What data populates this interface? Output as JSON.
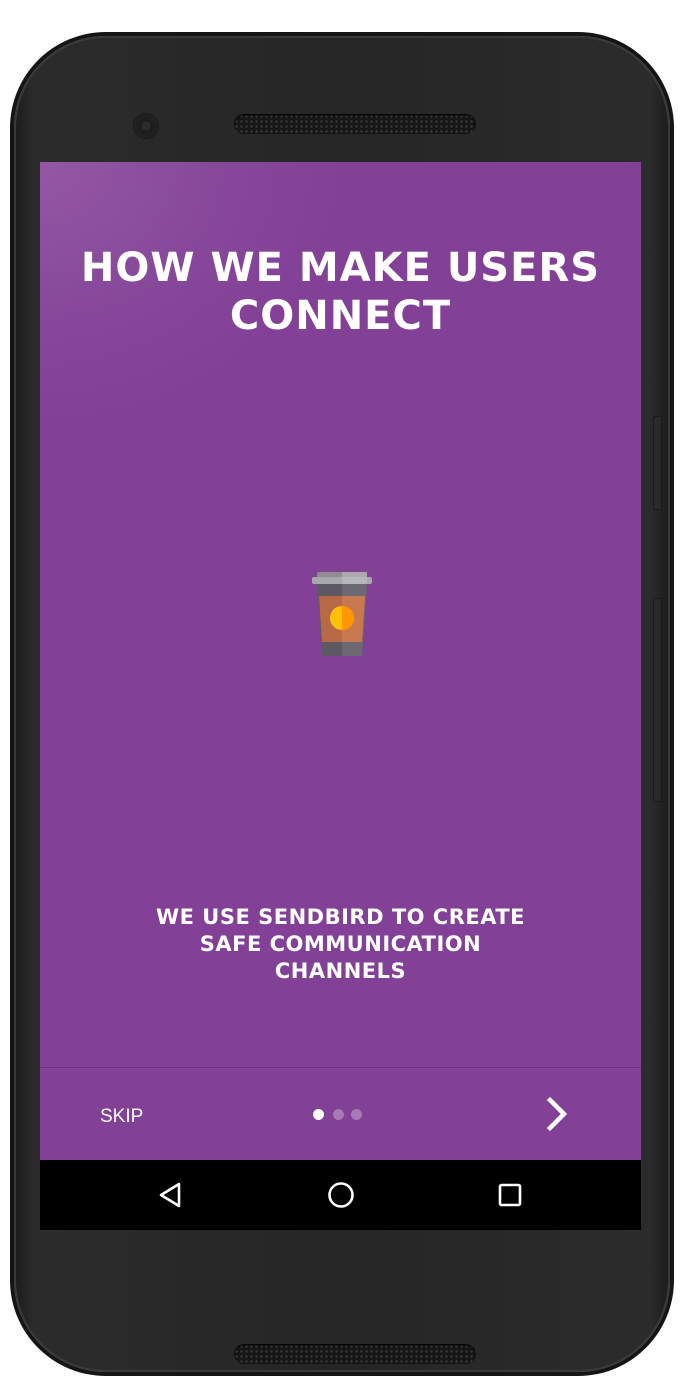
{
  "onboarding": {
    "title_lines": [
      "HOW WE MAKE USERS",
      "CONNECT"
    ],
    "illustration_icon": "coffee-cup-icon",
    "description_lines": [
      "WE USE SENDBIRD TO CREATE",
      "SAFE COMMUNICATION",
      "CHANNELS"
    ],
    "background_color": "#824096"
  },
  "footer": {
    "skip_label": "SKIP",
    "next_icon": "chevron-right-icon",
    "pagination": {
      "total_pages": 3,
      "current_page": 1,
      "active_color": "#ffffff",
      "inactive_color": "#a67bb5"
    }
  },
  "system_nav": {
    "back_icon": "triangle-back-icon",
    "home_icon": "circle-home-icon",
    "recents_icon": "square-recents-icon"
  }
}
